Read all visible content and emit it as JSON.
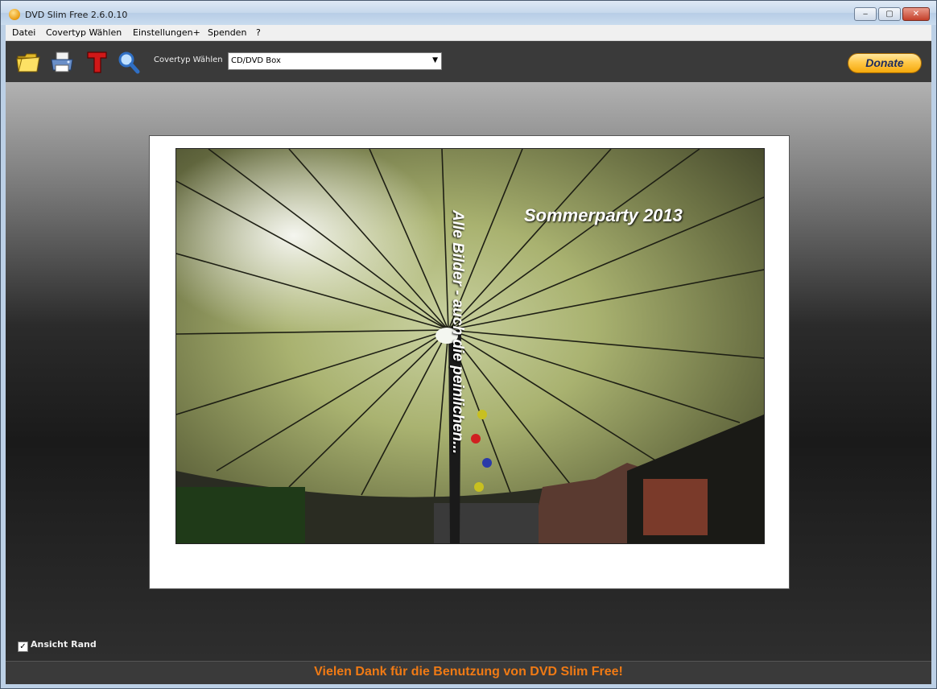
{
  "window": {
    "title": "DVD Slim Free 2.6.0.10"
  },
  "titlebar_buttons": {
    "minimize": "‒",
    "maximize": "▢",
    "close": "✕"
  },
  "menu": [
    "Datei",
    "Covertyp Wählen",
    "Einstellungen+",
    "Spenden",
    "?"
  ],
  "toolbar": {
    "icons": [
      "folder-open-icon",
      "printer-icon",
      "text-icon",
      "zoom-icon"
    ],
    "cover_label": "Covertyp Wählen",
    "cover_select_value": "CD/DVD Box",
    "donate_label": "Donate"
  },
  "cover": {
    "title": "Sommerparty 2013",
    "vertical_text": "Alle Bilder - auch die peinlichen..."
  },
  "options": {
    "border_view_label": "Ansicht Rand",
    "border_view_checked": true
  },
  "status": {
    "text": "Vielen Dank für die Benutzung von DVD Slim Free!"
  }
}
